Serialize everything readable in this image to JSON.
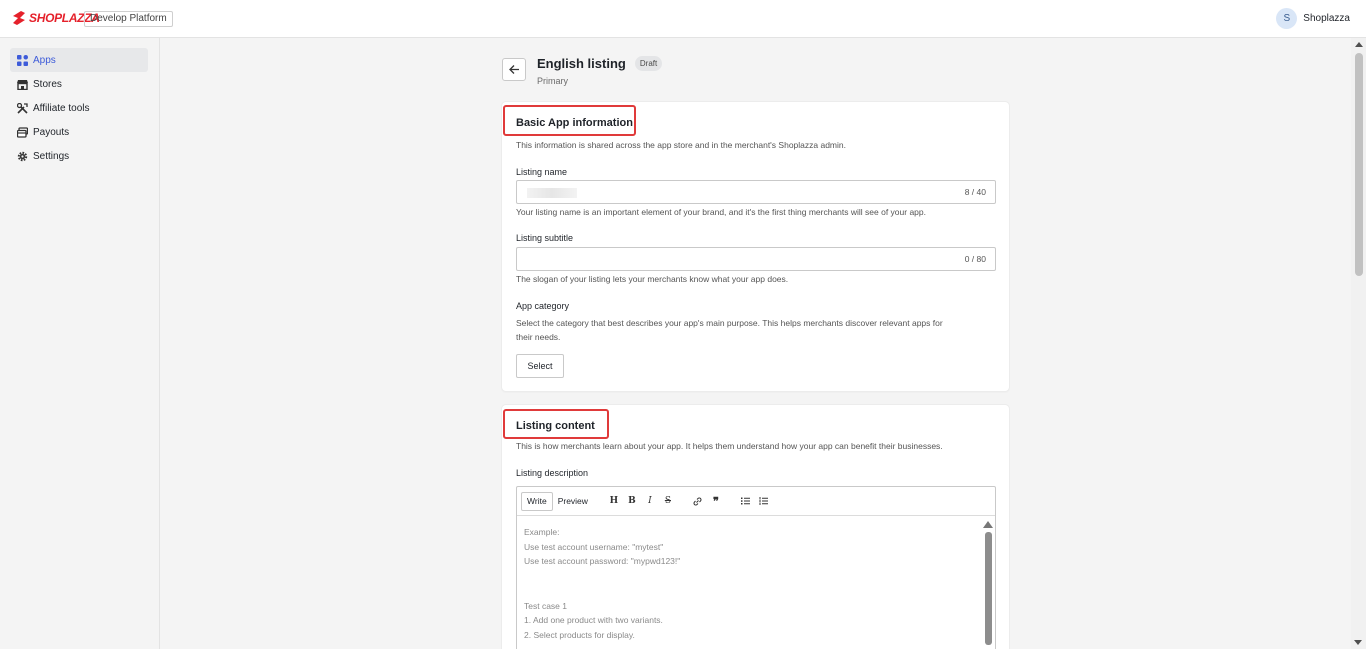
{
  "header": {
    "logo_text": "SHOPLAZZA",
    "platform": "Develop Platform",
    "user_initial": "S",
    "user_name": "Shoplazza"
  },
  "sidebar": {
    "items": [
      {
        "label": "Apps",
        "icon": "grid-icon",
        "active": true
      },
      {
        "label": "Stores",
        "icon": "store-icon"
      },
      {
        "label": "Affiliate tools",
        "icon": "tools-icon"
      },
      {
        "label": "Payouts",
        "icon": "payouts-icon"
      },
      {
        "label": "Settings",
        "icon": "gear-icon"
      }
    ]
  },
  "page": {
    "title": "English listing",
    "badge": "Draft",
    "subtitle": "Primary"
  },
  "basic_info": {
    "title": "Basic App information",
    "description": "This information is shared across the app store and in the merchant's Shoplazza admin.",
    "listing_name": {
      "label": "Listing name",
      "counter": "8 / 40",
      "help": "Your listing name is an important element of your brand, and it's the first thing merchants will see of your app."
    },
    "listing_subtitle": {
      "label": "Listing subtitle",
      "counter": "0 / 80",
      "help": "The slogan of your listing lets your merchants know what your app does."
    },
    "category": {
      "label": "App category",
      "description_line1": "Select the category that best describes your app's main purpose. This helps merchants discover relevant apps for",
      "description_line2": "their needs.",
      "button": "Select"
    }
  },
  "listing_content": {
    "title": "Listing content",
    "description": "This is how merchants learn about your app. It helps them understand how your app can benefit their businesses.",
    "field_label": "Listing description",
    "editor": {
      "tab_write": "Write",
      "tab_preview": "Preview",
      "toolbar_icons": [
        "heading-icon",
        "bold-icon",
        "italic-icon",
        "strikethrough-icon",
        "link-icon",
        "quote-icon",
        "bullet-list-icon",
        "numbered-list-icon"
      ],
      "placeholder": "Example:\nUse test account username: \"mytest\"\nUse test account password: \"mypwd123!\"\n\n\nTest case 1\n1. Add one product with two variants.\n2. Select products for display."
    }
  },
  "colors": {
    "brand": "#e5212b",
    "active_nav": "#3d5bd9",
    "highlight": "#e03a3a"
  }
}
